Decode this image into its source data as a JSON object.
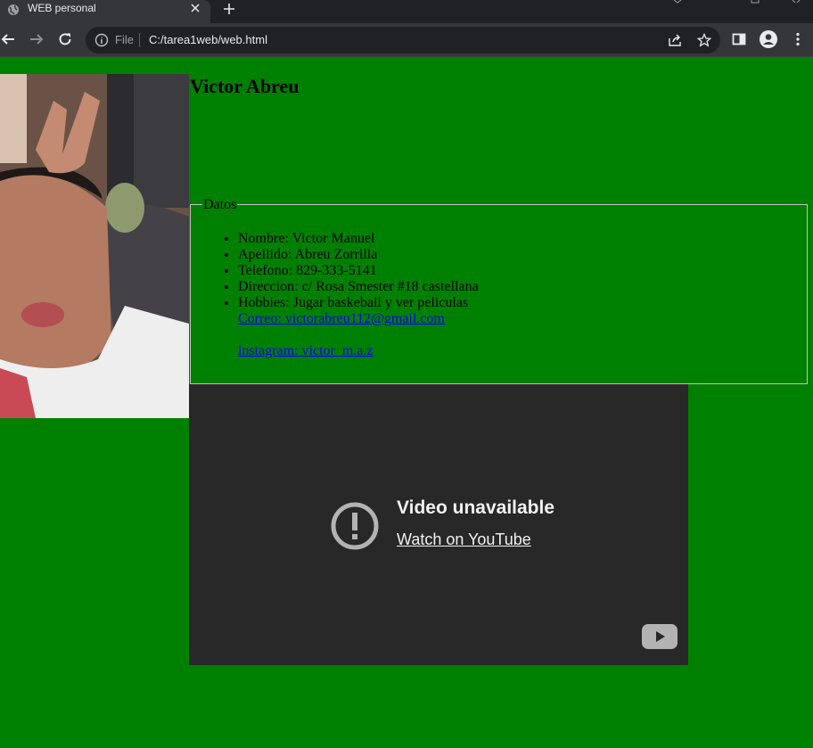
{
  "browser": {
    "tab_title": "WEB personal",
    "omnibox": {
      "scheme_label": "File",
      "url": "C:/tarea1web/web.html"
    }
  },
  "page": {
    "heading": "Victor Abreu",
    "datos": {
      "legend": "Datos",
      "items": [
        "Nombre: Victor Manuel",
        "Apellido: Abreu Zorrilla",
        "Telefono: 829-333-5141",
        "Direccion: c/ Rosa Smester #18 castellana",
        "Hobbies: Jugar baskeball y ver peliculas"
      ],
      "email_link": "Correo: victorabreu112@gmail.com",
      "instagram_link": "instagram: victor_m.a.z"
    },
    "video": {
      "title": "Video unavailable",
      "watch_link": "Watch on YouTube"
    }
  },
  "colors": {
    "page_background": "#008000",
    "link": "#0000ee",
    "video_background": "#282828"
  },
  "icons": [
    "globe-icon",
    "close-icon",
    "plus-icon",
    "back-arrow-icon",
    "forward-arrow-icon",
    "reload-icon",
    "info-icon",
    "share-icon",
    "star-icon",
    "sidebar-icon",
    "profile-icon",
    "menu-dots-icon",
    "alert-icon",
    "youtube-logo-icon"
  ]
}
